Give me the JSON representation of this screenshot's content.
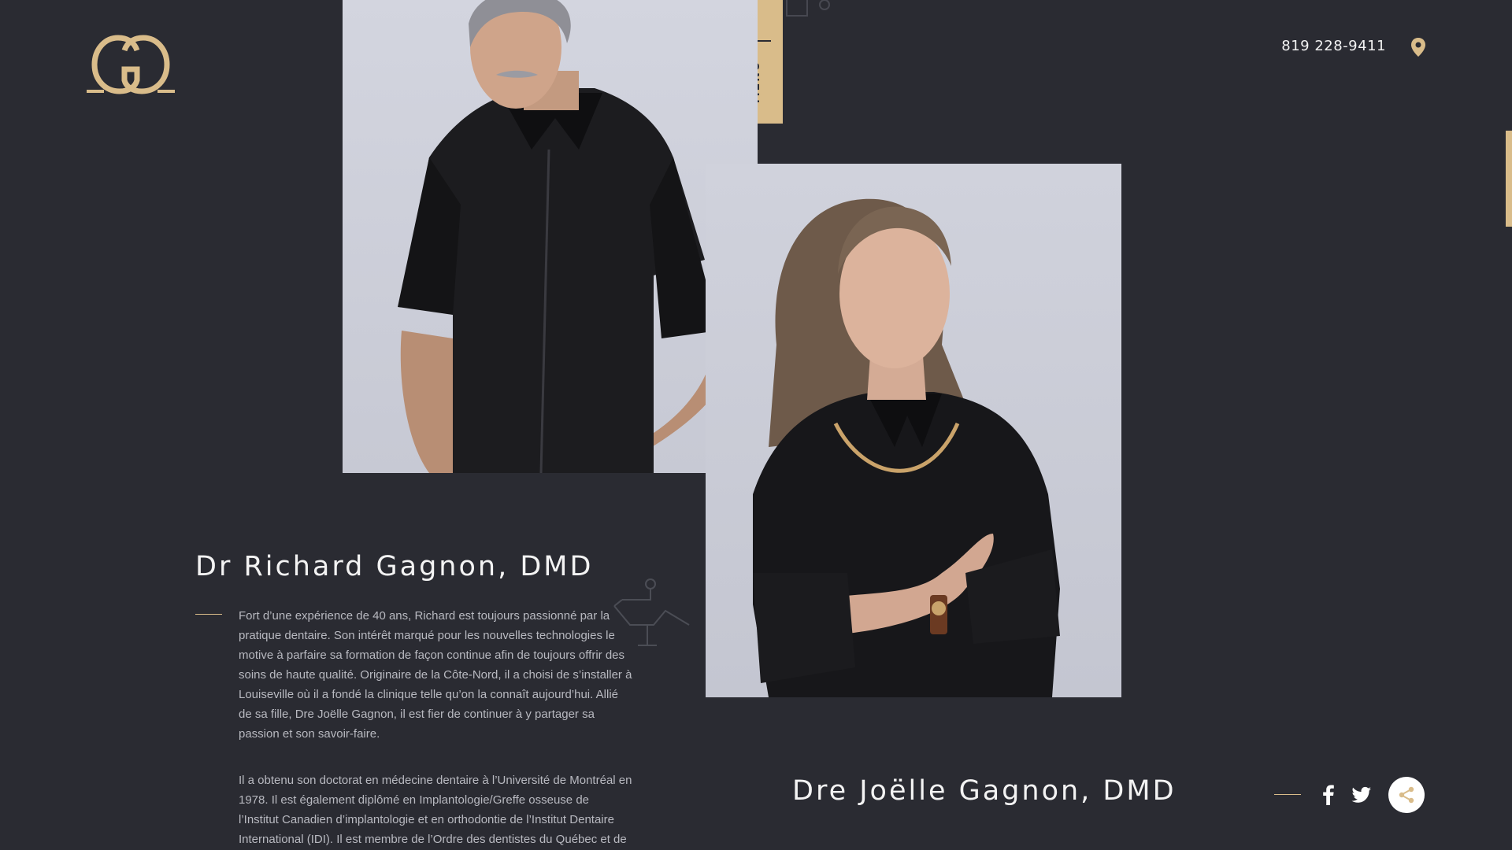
{
  "brand": {
    "logo_icon": "gg-monogram-logo",
    "accent_color": "#d9bc8a",
    "background_color": "#2a2b32"
  },
  "header": {
    "phone": "819 228-9411",
    "location_icon": "map-pin-icon",
    "menu_label": "MENU",
    "menu_icon": "hamburger-lines-icon"
  },
  "dentists": [
    {
      "name": "Dr Richard Gagnon, DMD",
      "bio": [
        "Fort d’une expérience de 40 ans, Richard est toujours passionné par la pratique dentaire. Son intérêt marqué pour les nouvelles technologies le motive à parfaire sa formation de façon continue afin de toujours offrir des soins de haute qualité. Originaire de la Côte-Nord, il a choisi de s’installer à Louiseville où il a fondé la clinique telle qu’on la connaît aujourd’hui. Allié de sa fille, Dre Joëlle Gagnon, il est fier de continuer à y partager sa passion et son savoir-faire.",
        "Il a obtenu son doctorat en médecine dentaire à l’Université de Montréal en 1978. Il est également diplômé en Implantologie/Greffe osseuse de l’Institut Canadien d’implantologie et en orthodontie de l’Institut Dentaire International (IDI). Il est membre de l’Ordre des dentistes du Québec et de"
      ]
    },
    {
      "name": "Dre Joëlle Gagnon, DMD"
    }
  ],
  "social": {
    "facebook_icon": "facebook-icon",
    "twitter_icon": "twitter-icon",
    "share_icon": "share-icon"
  }
}
